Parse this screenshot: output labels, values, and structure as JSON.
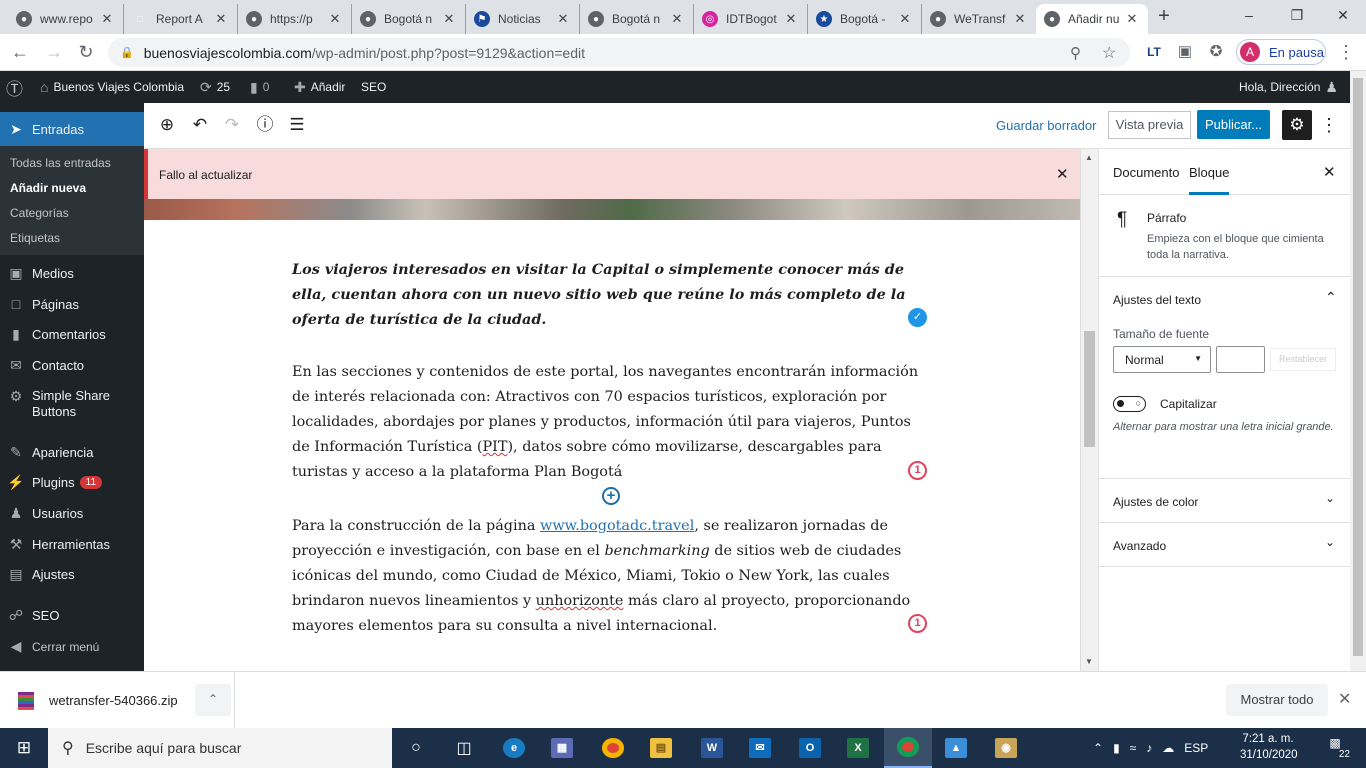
{
  "browser": {
    "tabs": [
      {
        "title": "www.repo",
        "icon": "globe-icon",
        "color": "#5f6368"
      },
      {
        "title": "Report A",
        "icon": "doc-icon",
        "color": "#dee1e6"
      },
      {
        "title": "https://p",
        "icon": "globe-icon",
        "color": "#5f6368"
      },
      {
        "title": "Bogotá n",
        "icon": "globe-icon",
        "color": "#5f6368"
      },
      {
        "title": "Noticias",
        "icon": "ribbon-icon",
        "color": "#1a4a9c"
      },
      {
        "title": "Bogotá n",
        "icon": "globe-icon",
        "color": "#5f6368"
      },
      {
        "title": "IDTBogot",
        "icon": "instagram-icon",
        "color": "#d6249f"
      },
      {
        "title": "Bogotá -",
        "icon": "star-logo-icon",
        "color": "#1a4a9c"
      },
      {
        "title": "WeTransf",
        "icon": "globe-icon",
        "color": "#5f6368"
      },
      {
        "title": "Añadir nu",
        "icon": "globe-icon",
        "color": "#5f6368"
      }
    ],
    "url_host": "buenosviajescolombia.com",
    "url_path": "/wp-admin/post.php?post=9129&action=edit",
    "profile_initial": "A",
    "profile_label": "En pausa",
    "extension_label": "LT"
  },
  "adminbar": {
    "site_name": "Buenos Viajes Colombia",
    "updates": "25",
    "comments": "0",
    "add_new": "Añadir",
    "seo": "SEO",
    "greeting": "Hola, Dirección"
  },
  "sidebar": {
    "current": "Entradas",
    "submenu": [
      "Todas las entradas",
      "Añadir nueva",
      "Categorías",
      "Etiquetas"
    ],
    "items": [
      "Medios",
      "Páginas",
      "Comentarios",
      "Contacto",
      "Simple Share Buttons",
      "Apariencia",
      "Plugins",
      "Usuarios",
      "Herramientas",
      "Ajustes",
      "SEO",
      "Cerrar menú"
    ],
    "plugins_badge": "11"
  },
  "editor": {
    "save_draft": "Guardar borrador",
    "preview": "Vista previa",
    "publish": "Publicar...",
    "notice": "Fallo al actualizar"
  },
  "content": {
    "lead": "Los viajeros interesados  en  visitar la Capital o simplemente conocer más de ella, cuentan ahora con un nuevo sitio web que reúne  lo más completo de la oferta de turística de la ciudad.",
    "p2_part1": " En las secciones y contenidos de este portal, los navegantes encontrarán información de interés relacionada con: Atractivos con 70 espacios turísticos, exploración por localidades, abordajes  por  planes y productos, información útil para viajeros, Puntos de Información Turística (",
    "p2_mis": "PIT",
    "p2_part2": "), datos sobre cómo movilizarse, descargables para turistas y acceso a la plataforma Plan Bogotá",
    "p3_part1": "Para la construcción de la página ",
    "p3_link": "www.bogotadc.travel",
    "p3_part2": ", se realizaron jornadas de proyección e investigación, con base en el ",
    "p3_em": "benchmarking",
    "p3_part3": " de sitios web de ciudades icónicas del mundo, como Ciudad de México, Miami, Tokio o New York, las cuales brindaron nuevos lineamientos y ",
    "p3_mis": "unhorizonte",
    "p3_part4": " más claro al proyecto, proporcionando mayores elementos para su consulta a nivel internacional.",
    "issue_count": "1"
  },
  "settings_panel": {
    "tab_document": "Documento",
    "tab_block": "Bloque",
    "block_name": "Párrafo",
    "block_desc": "Empieza con el bloque que cimienta toda la narrativa.",
    "text_settings": "Ajustes del texto",
    "font_size_label": "Tamaño de fuente",
    "font_size_value": "Normal",
    "reset": "Restablecer",
    "dropcap": "Capitalizar",
    "dropcap_help": "Alternar para mostrar una letra inicial grande.",
    "color_settings": "Ajustes de color",
    "advanced": "Avanzado"
  },
  "downloads": {
    "file": "wetransfer-540366.zip",
    "show_all": "Mostrar todo"
  },
  "taskbar": {
    "search_placeholder": "Escribe aquí para buscar",
    "lang": "ESP",
    "time": "7:21 a. m.",
    "date": "31/10/2020",
    "notifications": "22"
  }
}
